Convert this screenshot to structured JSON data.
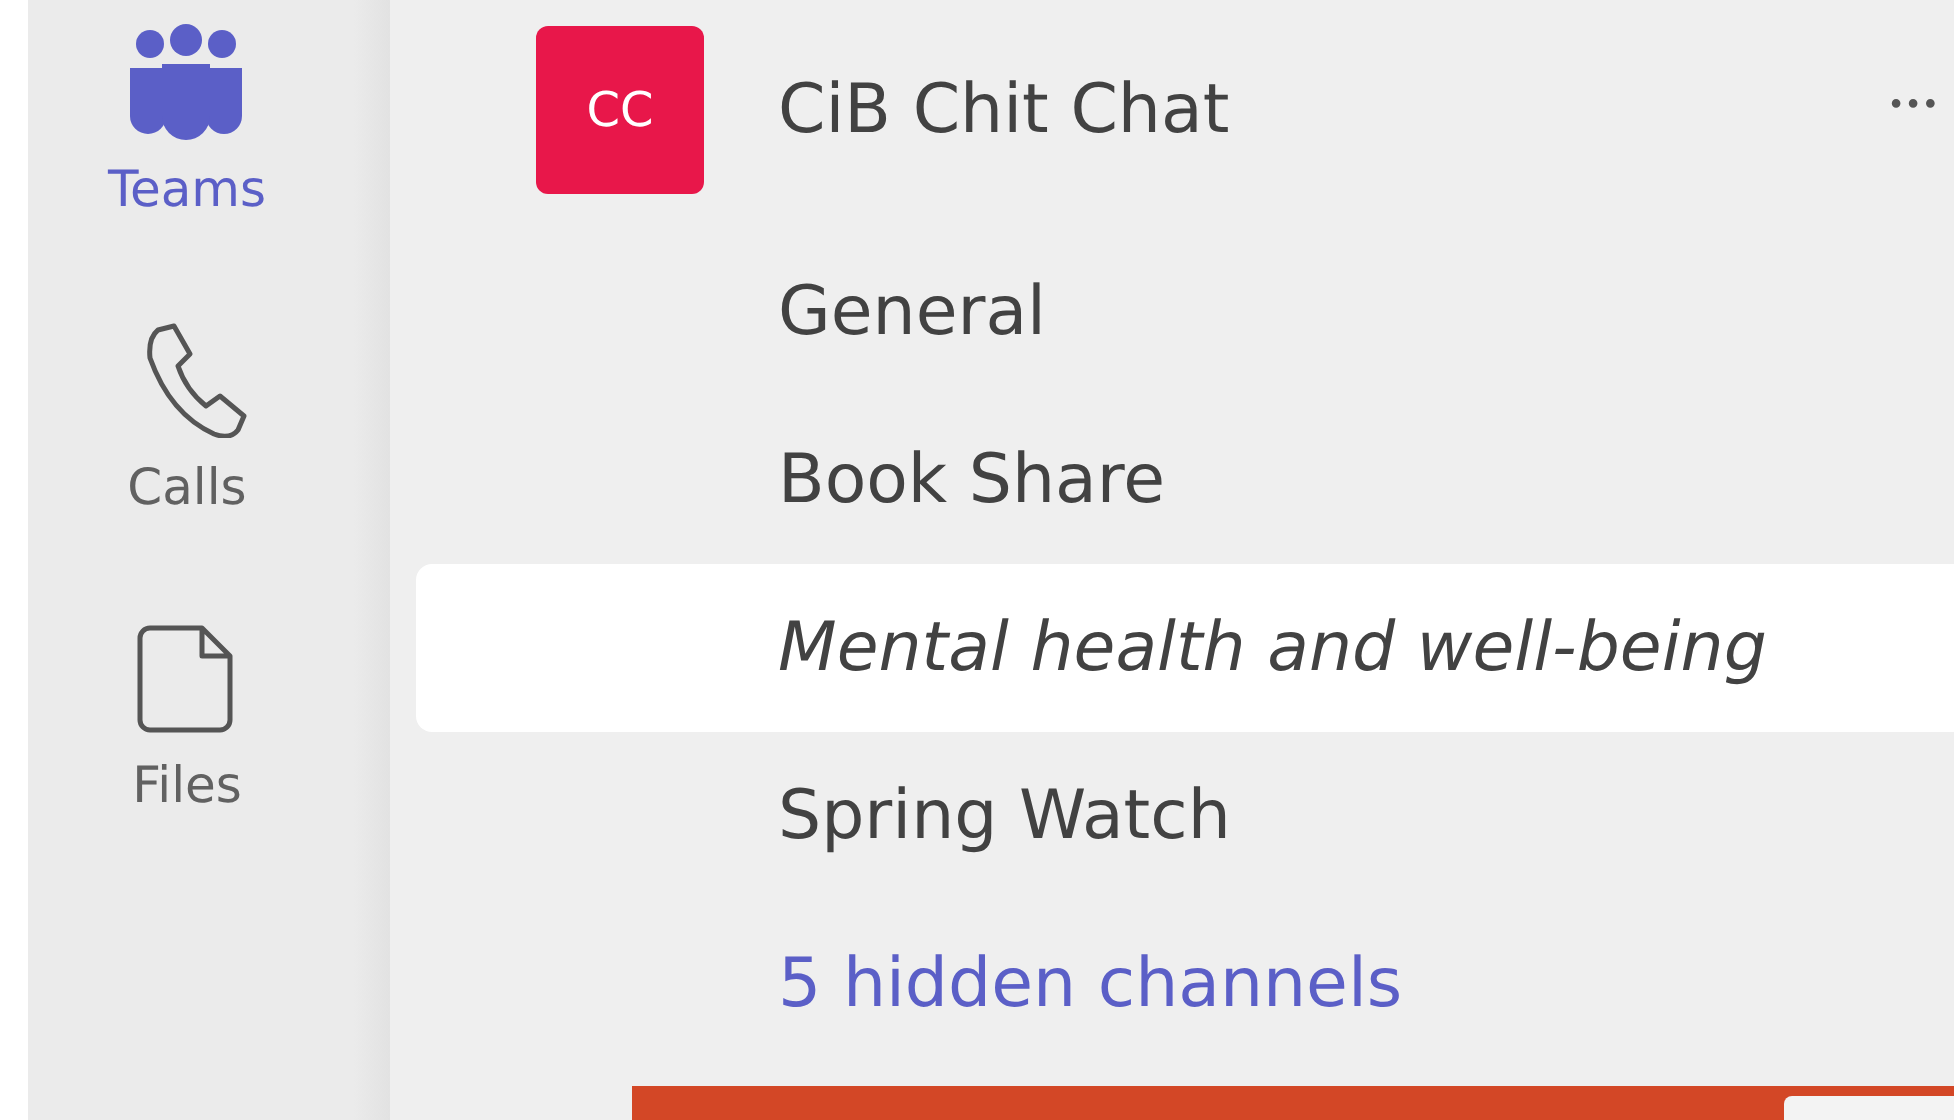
{
  "rail": [
    {
      "label": "Teams",
      "kind": "teams",
      "selected": true
    },
    {
      "label": "Calls",
      "kind": "calls",
      "selected": false
    },
    {
      "label": "Files",
      "kind": "files",
      "selected": false
    }
  ],
  "team": {
    "initials": "CC",
    "name": "CiB Chit Chat",
    "more": "•••"
  },
  "channels": [
    {
      "label": "General",
      "kind": "channel",
      "selected": false
    },
    {
      "label": "Book Share",
      "kind": "channel",
      "selected": false
    },
    {
      "label": "Mental health and well-being",
      "kind": "channel",
      "selected": true
    },
    {
      "label": "Spring Watch",
      "kind": "channel",
      "selected": false
    },
    {
      "label": "5 hidden channels",
      "kind": "link",
      "selected": false
    }
  ]
}
